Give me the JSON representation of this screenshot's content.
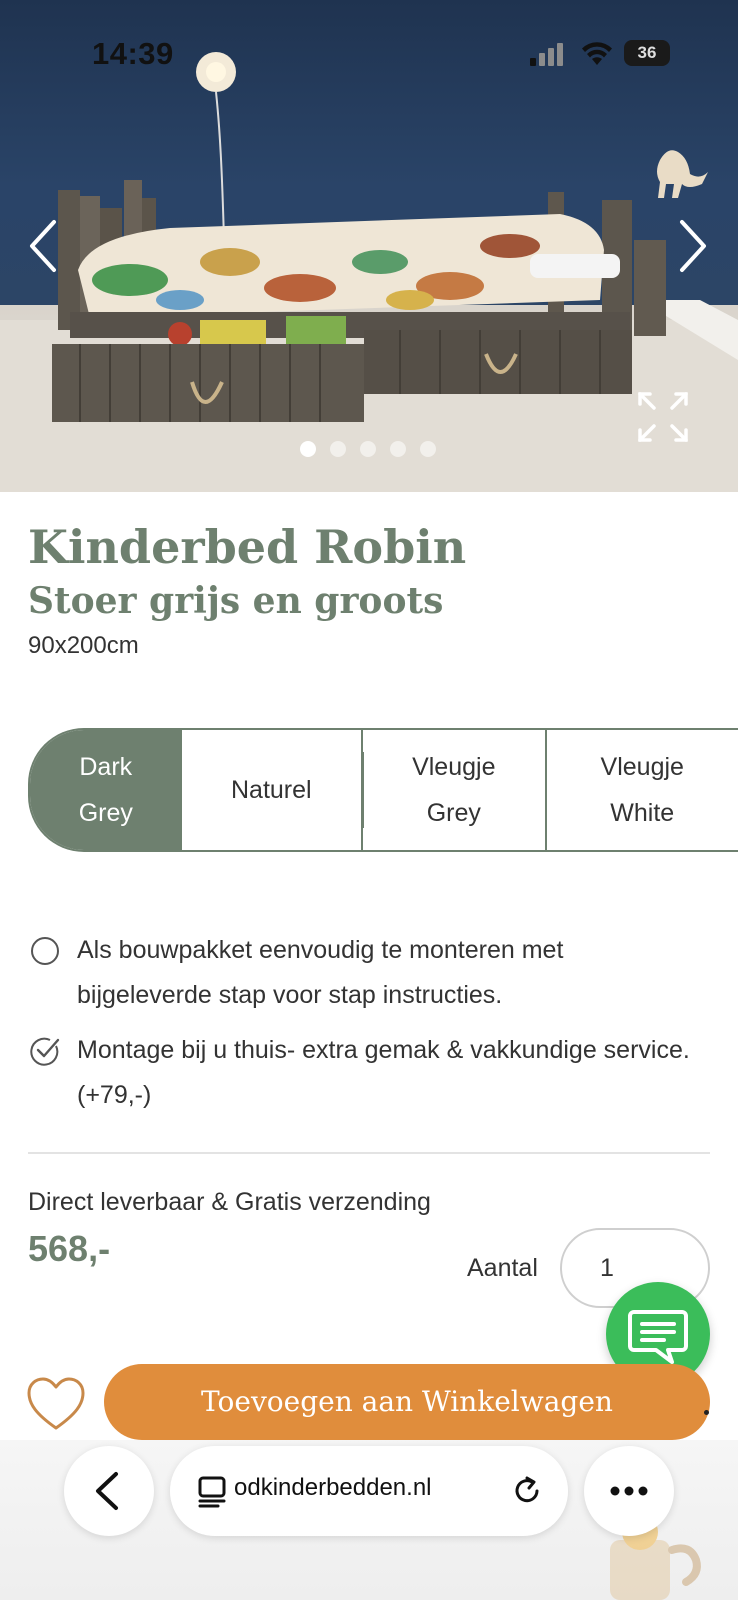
{
  "status_bar": {
    "time": "14:39",
    "battery": "36",
    "icons": [
      "cellular-signal-icon",
      "wifi-icon",
      "battery-icon"
    ]
  },
  "gallery": {
    "slide_count": 5,
    "active_index": 0,
    "icons": [
      "chevron-left-icon",
      "chevron-right-icon",
      "expand-icon"
    ]
  },
  "product": {
    "title": "Kinderbed Robin",
    "subtitle": "Stoer grijs en groots",
    "size": "90x200cm"
  },
  "variants": [
    {
      "line1": "Dark",
      "line2": "Grey",
      "selected": true
    },
    {
      "line1": "Naturel",
      "line2": "",
      "selected": false
    },
    {
      "line1": "Vleugje",
      "line2": "Grey",
      "selected": false
    },
    {
      "line1": "Vleugje",
      "line2": "White",
      "selected": false
    }
  ],
  "options": [
    {
      "text": "Als bouwpakket eenvoudig te monteren met bijgeleverde stap voor stap instructies.",
      "checked": false
    },
    {
      "text": "Montage bij u thuis- extra gemak & vakkundige service. (+79,-)",
      "checked": true
    }
  ],
  "purchase": {
    "delivery_text": "Direct leverbaar & Gratis verzending",
    "price": "568,-",
    "quantity_label": "Aantal",
    "quantity_value": "1",
    "add_to_cart_label": "Toevoegen aan Winkelwagen"
  },
  "browser": {
    "url": "odkinderbedden.nl",
    "icons": [
      "back-icon",
      "tabs-icon",
      "reload-icon",
      "more-icon"
    ]
  },
  "colors": {
    "accent_green": "#6e806f",
    "cart_orange": "#e08d3c",
    "chat_green": "#3bbd5a"
  }
}
